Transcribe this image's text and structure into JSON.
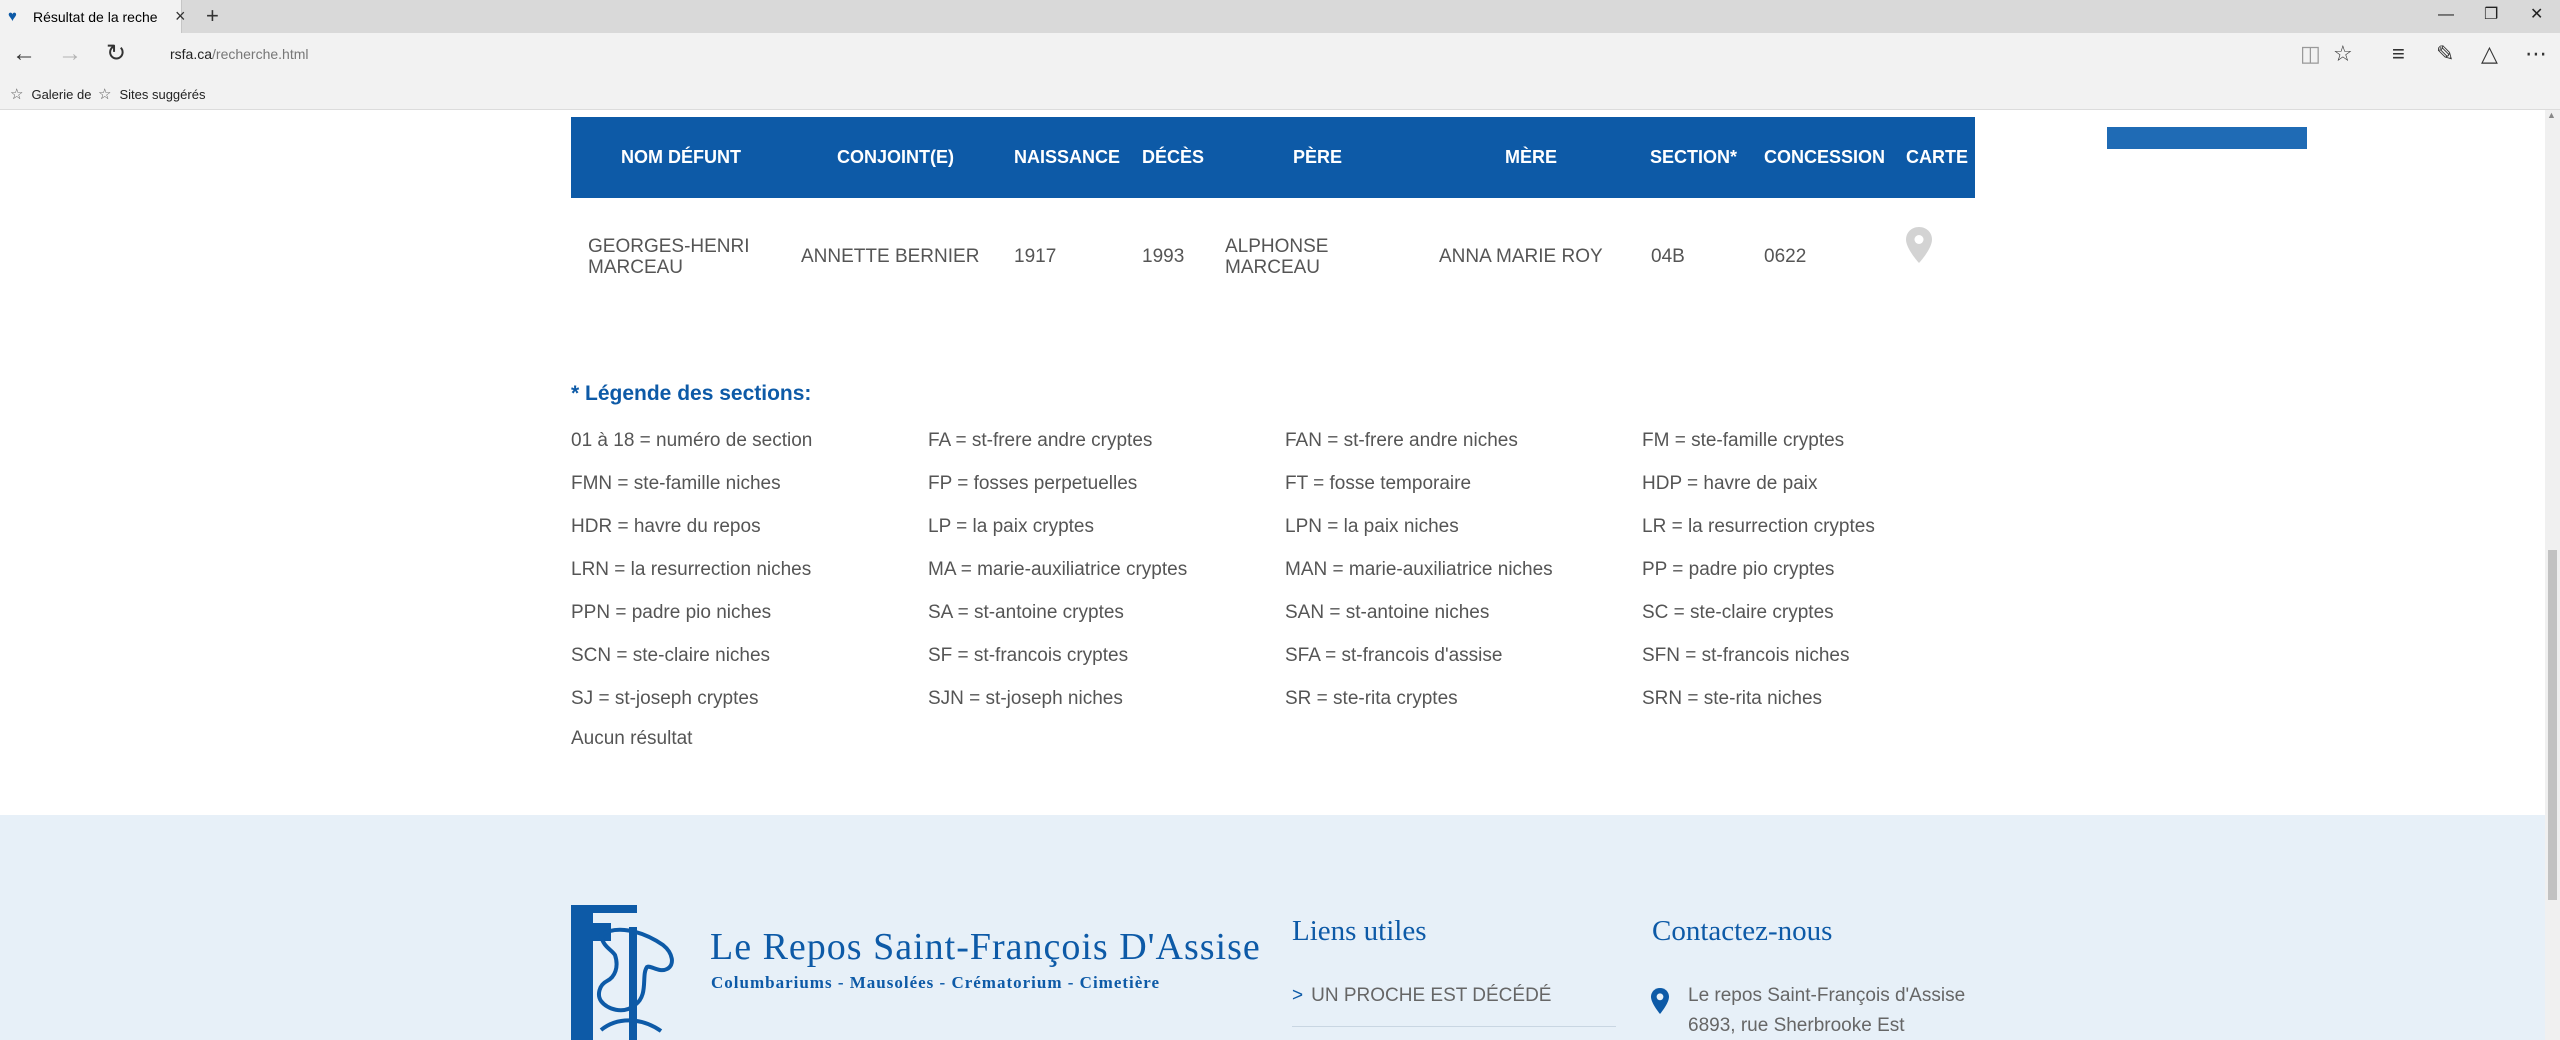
{
  "browser": {
    "tab_title": "Résultat de la recherche",
    "url_host": "rsfa.ca",
    "url_path": "/recherche.html",
    "favorites": [
      "Galerie de",
      "Sites suggérés"
    ]
  },
  "table": {
    "headers": [
      "NOM DÉFUNT",
      "CONJOINT(E)",
      "NAISSANCE",
      "DÉCÈS",
      "PÈRE",
      "MÈRE",
      "SECTION*",
      "CONCESSION",
      "CARTE"
    ],
    "rows": [
      {
        "nom_line1": "GEORGES-HENRI",
        "nom_line2": "MARCEAU",
        "conjoint": "ANNETTE BERNIER",
        "naissance": "1917",
        "deces": "1993",
        "pere_line1": "ALPHONSE",
        "pere_line2": "MARCEAU",
        "mere": "ANNA MARIE ROY",
        "section": "04B",
        "concession": "0622"
      }
    ]
  },
  "legend": {
    "title": "* Légende des sections:",
    "items": [
      "01 à 18 = numéro de section",
      "FA = st-frere andre cryptes",
      "FAN = st-frere andre niches",
      "FM = ste-famille cryptes",
      "FMN = ste-famille niches",
      "FP = fosses perpetuelles",
      "FT = fosse temporaire",
      "HDP = havre de paix",
      "HDR = havre du repos",
      "LP = la paix cryptes",
      "LPN = la paix niches",
      "LR = la resurrection cryptes",
      "LRN = la resurrection niches",
      "MA = marie-auxiliatrice cryptes",
      "MAN = marie-auxiliatrice niches",
      "PP = padre pio cryptes",
      "PPN = padre pio niches",
      "SA = st-antoine cryptes",
      "SAN = st-antoine niches",
      "SC = ste-claire cryptes",
      "SCN = ste-claire niches",
      "SF = st-francois cryptes",
      "SFA = st-francois d'assise",
      "SFN = st-francois niches",
      "SJ = st-joseph cryptes",
      "SJN = st-joseph niches",
      "SR = ste-rita cryptes",
      "SRN = ste-rita niches"
    ],
    "no_result": "Aucun résultat"
  },
  "footer": {
    "logo_title": "Le Repos Saint-François D'Assise",
    "logo_subtitle": "Columbariums - Mausolées - Crématorium - Cimetière",
    "links_heading": "Liens utiles",
    "link_1": "UN PROCHE EST DÉCÉDÉ",
    "contact_heading": "Contactez-nous",
    "contact_line1": "Le repos Saint-François d'Assise",
    "contact_line2": "6893, rue Sherbrooke Est"
  },
  "colors": {
    "brand": "#0d5aa7",
    "footer_bg": "#e7f0f8"
  }
}
